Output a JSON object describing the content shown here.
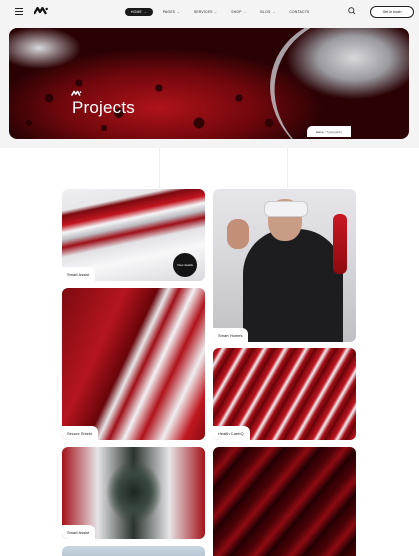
{
  "nav": {
    "items": [
      {
        "label": "HOME",
        "active": true
      },
      {
        "label": "PAGES",
        "active": false
      },
      {
        "label": "SERVICES",
        "active": false
      },
      {
        "label": "SHOP",
        "active": false
      },
      {
        "label": "BLOG",
        "active": false
      },
      {
        "label": "CONTACTS",
        "active": false
      }
    ],
    "chevron": "⌄"
  },
  "header": {
    "cta_label": "Get in touch",
    "icons": [
      "menu-icon",
      "logo-icon",
      "search-icon"
    ]
  },
  "hero": {
    "title": "Projects",
    "breadcrumb": {
      "home": "Home",
      "separator": "/",
      "current": "Typography"
    }
  },
  "projects": [
    {
      "label": "Smart Assist",
      "badge": "View details"
    },
    {
      "label": "Smart Homes"
    },
    {
      "label": "Secure Shield"
    },
    {
      "label": "Health CareIQ"
    },
    {
      "label": "Smart Assist"
    },
    {
      "label": ""
    }
  ],
  "colors": {
    "accent": "#c01722",
    "dark": "#141414",
    "background": "#f4f4f5"
  }
}
